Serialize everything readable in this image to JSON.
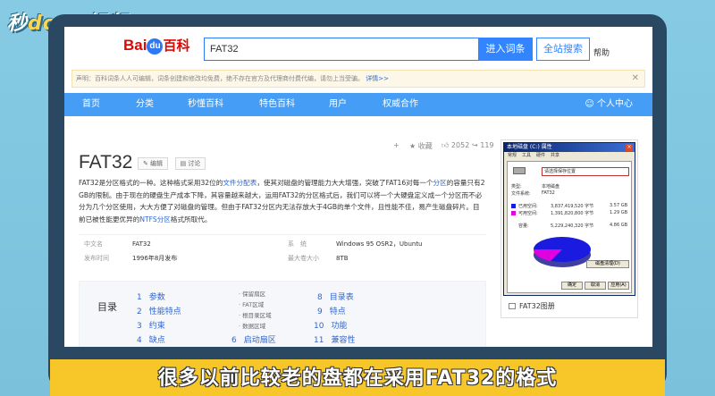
{
  "video_logo": {
    "part1": "秒",
    "part2": "dong",
    "part3": "视频"
  },
  "header": {
    "logo": {
      "bai": "Bai",
      "du": "du",
      "baike": "百科"
    },
    "search_value": "FAT32",
    "enter_btn": "进入词条",
    "site_btn": "全站搜索",
    "help": "帮助"
  },
  "notice": {
    "text": "声明：百科词条人人可编辑，词条创建和修改均免费，绝不存在官方及代理商付费代编，请勿上当受骗。",
    "more": "详情>>",
    "close": "✕"
  },
  "nav": {
    "items": [
      "首页",
      "分类",
      "秒懂百科",
      "特色百科",
      "用户",
      "权威合作"
    ],
    "user": "个人中心"
  },
  "toolbar": {
    "plus": "+",
    "collect": "收藏",
    "likes": "2052",
    "shares": "119"
  },
  "entry": {
    "title": "FAT32",
    "edit": "编辑",
    "discuss": "讨论",
    "summary_1": "FAT32是分区格式的一种。这种格式采用32位的",
    "summary_link1": "文件分配表",
    "summary_2": "，使其对磁盘的管理能力大大增强，突破了FAT16对每一个",
    "summary_link2": "分区",
    "summary_3": "的容量只有2 GB的限制。由于现在的硬盘生产成本下降，其容量越来越大，运用FAT32的分区格式后，我们可以将一个大硬盘定义成一个分区而不必分为几个分区使用，大大方便了对磁盘的管理。但由于FAT32分区内无法存放大于4GB的单个文件，且性能不佳，易产生磁盘碎片。目前已被性能更优异的",
    "summary_link3": "NTFS分区",
    "summary_4": "格式所取代。"
  },
  "infobox": {
    "rows": [
      {
        "k1": "中文名",
        "v1": "FAT32",
        "k2": "系　统",
        "v2": "Windows 95 OSR2，Ubuntu"
      },
      {
        "k1": "发布时间",
        "v1": "1996年8月发布",
        "k2": "最大卷大小",
        "v2": "8TB"
      }
    ]
  },
  "toc": {
    "heading": "目录",
    "items": [
      {
        "num": "1",
        "label": "参数"
      },
      {
        "num": "2",
        "label": "性能特点"
      },
      {
        "num": "3",
        "label": "约束"
      },
      {
        "num": "4",
        "label": "缺点"
      },
      {
        "num": "6",
        "label": "启动扇区"
      },
      {
        "num": "8",
        "label": "目录表"
      },
      {
        "num": "9",
        "label": "特点"
      },
      {
        "num": "10",
        "label": "功能"
      },
      {
        "num": "11",
        "label": "兼容性"
      }
    ],
    "subs": [
      "保留扇区",
      "FAT区域",
      "根目录区域",
      "数据区域"
    ]
  },
  "sidebar_image": {
    "window_title": "本地磁盘 (C:) 属性",
    "tabs": [
      "常规",
      "工具",
      "硬件",
      "共享"
    ],
    "name_value": "请选择保存位置",
    "type_label": "类型:",
    "type_value": "本地磁盘",
    "fs_label": "文件系统:",
    "fs_value": "FAT32",
    "used_label": "已用空间:",
    "used_bytes": "3,837,419,520 字节",
    "used_gb": "3.57 GB",
    "free_label": "可用空间:",
    "free_bytes": "1,391,820,800 字节",
    "free_gb": "1.29 GB",
    "cap_label": "容量:",
    "cap_bytes": "5,229,240,320 字节",
    "cap_gb": "4.86 GB",
    "cleanup": "磁盘清理(D)",
    "ok": "确定",
    "cancel": "取消",
    "apply": "应用(A)",
    "caption": "FAT32图册",
    "used_color": "#1a1ae0",
    "free_color": "#e000e0"
  },
  "subtitle": "很多以前比较老的盘都在采用FAT32的格式"
}
